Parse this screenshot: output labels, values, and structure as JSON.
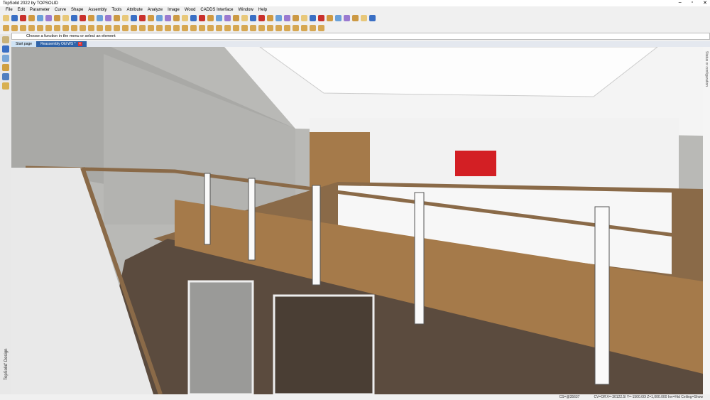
{
  "window": {
    "title": "TopSolid 2022 by TOPSOLID"
  },
  "menu": [
    "File",
    "Edit",
    "Parameter",
    "Curve",
    "Shape",
    "Assembly",
    "Tools",
    "Attribute",
    "Analyze",
    "Image",
    "Wood",
    "CADDS Interface",
    "Window",
    "Help"
  ],
  "prompt": "Choose a function in the menu or select an element",
  "tabs": [
    {
      "label": "Start page"
    },
    {
      "label": "Reassembly Old WS *"
    }
  ],
  "side_panel": "Status or configuration",
  "brand": "TopSolid' Design",
  "status": {
    "cs": "CS=@35637",
    "coords": "CV=Off  X=-30122.5l  Y=-1500.00l  Z=1,000.000  Inv=Hid  Ceiling=Show"
  },
  "colors": {
    "accent": "#2f63a8",
    "wood": "#a57a4a",
    "floor": "#5b4b3e"
  }
}
